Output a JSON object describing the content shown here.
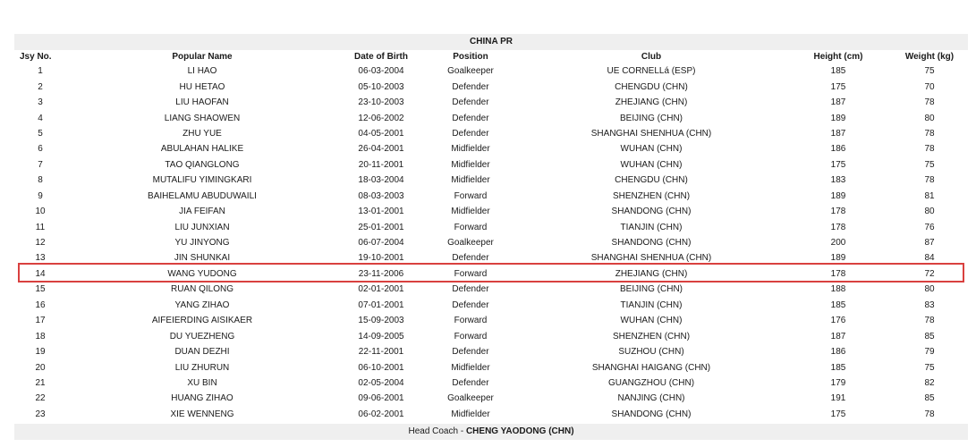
{
  "team_title": "CHINA PR",
  "headers": {
    "jsy": "Jsy No.",
    "name": "Popular Name",
    "dob": "Date of Birth",
    "position": "Position",
    "club": "Club",
    "height": "Height (cm)",
    "weight": "Weight (kg)"
  },
  "players": [
    {
      "no": "1",
      "name": "LI HAO",
      "dob": "06-03-2004",
      "position": "Goalkeeper",
      "club": "UE CORNELLá (ESP)",
      "height": "185",
      "weight": "75"
    },
    {
      "no": "2",
      "name": "HU HETAO",
      "dob": "05-10-2003",
      "position": "Defender",
      "club": "CHENGDU (CHN)",
      "height": "175",
      "weight": "70"
    },
    {
      "no": "3",
      "name": "LIU HAOFAN",
      "dob": "23-10-2003",
      "position": "Defender",
      "club": "ZHEJIANG (CHN)",
      "height": "187",
      "weight": "78"
    },
    {
      "no": "4",
      "name": "LIANG SHAOWEN",
      "dob": "12-06-2002",
      "position": "Defender",
      "club": "BEIJING (CHN)",
      "height": "189",
      "weight": "80"
    },
    {
      "no": "5",
      "name": "ZHU YUE",
      "dob": "04-05-2001",
      "position": "Defender",
      "club": "SHANGHAI SHENHUA (CHN)",
      "height": "187",
      "weight": "78"
    },
    {
      "no": "6",
      "name": "ABULAHAN HALIKE",
      "dob": "26-04-2001",
      "position": "Midfielder",
      "club": "WUHAN (CHN)",
      "height": "186",
      "weight": "78"
    },
    {
      "no": "7",
      "name": "TAO QIANGLONG",
      "dob": "20-11-2001",
      "position": "Midfielder",
      "club": "WUHAN (CHN)",
      "height": "175",
      "weight": "75"
    },
    {
      "no": "8",
      "name": "MUTALIFU YIMINGKARI",
      "dob": "18-03-2004",
      "position": "Midfielder",
      "club": "CHENGDU (CHN)",
      "height": "183",
      "weight": "78"
    },
    {
      "no": "9",
      "name": "BAIHELAMU ABUDUWAILI",
      "dob": "08-03-2003",
      "position": "Forward",
      "club": "SHENZHEN (CHN)",
      "height": "189",
      "weight": "81"
    },
    {
      "no": "10",
      "name": "JIA FEIFAN",
      "dob": "13-01-2001",
      "position": "Midfielder",
      "club": "SHANDONG (CHN)",
      "height": "178",
      "weight": "80"
    },
    {
      "no": "11",
      "name": "LIU JUNXIAN",
      "dob": "25-01-2001",
      "position": "Forward",
      "club": "TIANJIN (CHN)",
      "height": "178",
      "weight": "76"
    },
    {
      "no": "12",
      "name": "YU JINYONG",
      "dob": "06-07-2004",
      "position": "Goalkeeper",
      "club": "SHANDONG (CHN)",
      "height": "200",
      "weight": "87"
    },
    {
      "no": "13",
      "name": "JIN SHUNKAI",
      "dob": "19-10-2001",
      "position": "Defender",
      "club": "SHANGHAI SHENHUA (CHN)",
      "height": "189",
      "weight": "84"
    },
    {
      "no": "14",
      "name": "WANG YUDONG",
      "dob": "23-11-2006",
      "position": "Forward",
      "club": "ZHEJIANG (CHN)",
      "height": "178",
      "weight": "72"
    },
    {
      "no": "15",
      "name": "RUAN QILONG",
      "dob": "02-01-2001",
      "position": "Defender",
      "club": "BEIJING (CHN)",
      "height": "188",
      "weight": "80"
    },
    {
      "no": "16",
      "name": "YANG ZIHAO",
      "dob": "07-01-2001",
      "position": "Defender",
      "club": "TIANJIN (CHN)",
      "height": "185",
      "weight": "83"
    },
    {
      "no": "17",
      "name": "AIFEIERDING AISIKAER",
      "dob": "15-09-2003",
      "position": "Forward",
      "club": "WUHAN (CHN)",
      "height": "176",
      "weight": "78"
    },
    {
      "no": "18",
      "name": "DU YUEZHENG",
      "dob": "14-09-2005",
      "position": "Forward",
      "club": "SHENZHEN (CHN)",
      "height": "187",
      "weight": "85"
    },
    {
      "no": "19",
      "name": "DUAN DEZHI",
      "dob": "22-11-2001",
      "position": "Defender",
      "club": "SUZHOU (CHN)",
      "height": "186",
      "weight": "79"
    },
    {
      "no": "20",
      "name": "LIU ZHURUN",
      "dob": "06-10-2001",
      "position": "Midfielder",
      "club": "SHANGHAI HAIGANG (CHN)",
      "height": "185",
      "weight": "75"
    },
    {
      "no": "21",
      "name": "XU BIN",
      "dob": "02-05-2004",
      "position": "Defender",
      "club": "GUANGZHOU (CHN)",
      "height": "179",
      "weight": "82"
    },
    {
      "no": "22",
      "name": "HUANG ZIHAO",
      "dob": "09-06-2001",
      "position": "Goalkeeper",
      "club": "NANJING (CHN)",
      "height": "191",
      "weight": "85"
    },
    {
      "no": "23",
      "name": "XIE WENNENG",
      "dob": "06-02-2001",
      "position": "Midfielder",
      "club": "SHANDONG (CHN)",
      "height": "175",
      "weight": "78"
    }
  ],
  "highlight_color": "#d9403f",
  "footer": {
    "label": "Head Coach - ",
    "coach": "CHENG YAODONG (CHN)"
  }
}
